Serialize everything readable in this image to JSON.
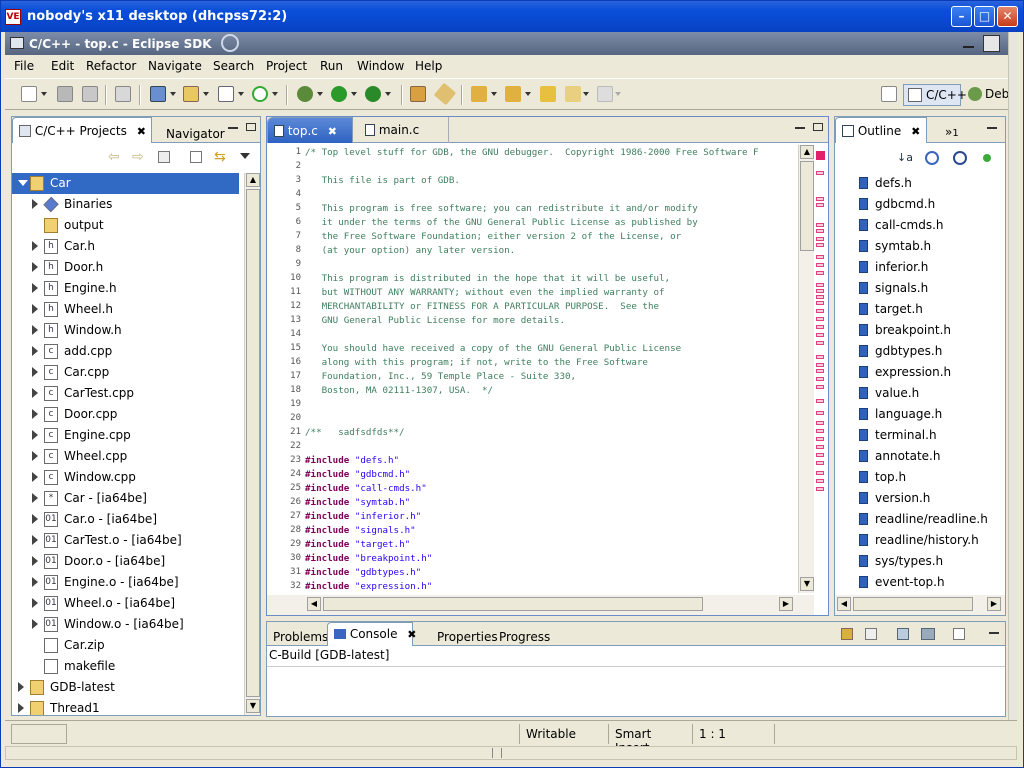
{
  "outer_window": {
    "icon": "VE",
    "title": "nobody's x11 desktop (dhcpss72:2)"
  },
  "eclipse_window": {
    "title": "C/C++ - top.c - Eclipse SDK"
  },
  "menu": [
    "File",
    "Edit",
    "Refactor",
    "Navigate",
    "Search",
    "Project",
    "Run",
    "Window",
    "Help"
  ],
  "perspectives": {
    "cpp": "C/C++",
    "debug": "Deb"
  },
  "project_view": {
    "tabs": [
      "C/C++ Projects",
      "Navigator"
    ],
    "tree": [
      {
        "label": "Car",
        "icon": "project-folder-icon",
        "expander": "open",
        "level": 0,
        "selected": true
      },
      {
        "label": "Binaries",
        "icon": "binaries-icon",
        "expander": "closed",
        "level": 1
      },
      {
        "label": "output",
        "icon": "folder-icon",
        "expander": "none",
        "level": 1
      },
      {
        "label": "Car.h",
        "icon": "header-file-icon",
        "expander": "closed",
        "level": 1
      },
      {
        "label": "Door.h",
        "icon": "header-file-icon",
        "expander": "closed",
        "level": 1
      },
      {
        "label": "Engine.h",
        "icon": "header-file-icon",
        "expander": "closed",
        "level": 1
      },
      {
        "label": "Wheel.h",
        "icon": "header-file-icon",
        "expander": "closed",
        "level": 1
      },
      {
        "label": "Window.h",
        "icon": "header-file-icon",
        "expander": "closed",
        "level": 1
      },
      {
        "label": "add.cpp",
        "icon": "source-file-icon",
        "expander": "closed",
        "level": 1
      },
      {
        "label": "Car.cpp",
        "icon": "source-file-icon",
        "expander": "closed",
        "level": 1
      },
      {
        "label": "CarTest.cpp",
        "icon": "source-file-icon",
        "expander": "closed",
        "level": 1
      },
      {
        "label": "Door.cpp",
        "icon": "source-file-icon",
        "expander": "closed",
        "level": 1
      },
      {
        "label": "Engine.cpp",
        "icon": "source-file-icon",
        "expander": "closed",
        "level": 1
      },
      {
        "label": "Wheel.cpp",
        "icon": "source-file-icon",
        "expander": "closed",
        "level": 1
      },
      {
        "label": "Window.cpp",
        "icon": "source-file-icon",
        "expander": "closed",
        "level": 1
      },
      {
        "label": "Car - [ia64be]",
        "icon": "executable-icon",
        "expander": "closed",
        "level": 1
      },
      {
        "label": "Car.o - [ia64be]",
        "icon": "object-file-icon",
        "expander": "closed",
        "level": 1
      },
      {
        "label": "CarTest.o - [ia64be]",
        "icon": "object-file-icon",
        "expander": "closed",
        "level": 1
      },
      {
        "label": "Door.o - [ia64be]",
        "icon": "object-file-icon",
        "expander": "closed",
        "level": 1
      },
      {
        "label": "Engine.o - [ia64be]",
        "icon": "object-file-icon",
        "expander": "closed",
        "level": 1
      },
      {
        "label": "Wheel.o - [ia64be]",
        "icon": "object-file-icon",
        "expander": "closed",
        "level": 1
      },
      {
        "label": "Window.o - [ia64be]",
        "icon": "object-file-icon",
        "expander": "closed",
        "level": 1
      },
      {
        "label": "Car.zip",
        "icon": "file-icon",
        "expander": "none",
        "level": 1
      },
      {
        "label": "makefile",
        "icon": "makefile-icon",
        "expander": "none",
        "level": 1
      },
      {
        "label": "GDB-latest",
        "icon": "project-folder-icon",
        "expander": "closed",
        "level": 0
      },
      {
        "label": "Thread1",
        "icon": "project-folder-icon",
        "expander": "closed",
        "level": 0
      }
    ]
  },
  "editor": {
    "tabs": [
      "top.c",
      "main.c"
    ],
    "lines": [
      {
        "n": "1",
        "t": "/* Top level stuff for GDB, the GNU debugger.  Copyright 1986-2000 Free Software F",
        "k": "cmt"
      },
      {
        "n": "2",
        "t": "",
        "k": "cmt"
      },
      {
        "n": "3",
        "t": "   This file is part of GDB.",
        "k": "cmt"
      },
      {
        "n": "4",
        "t": "",
        "k": "cmt"
      },
      {
        "n": "5",
        "t": "   This program is free software; you can redistribute it and/or modify",
        "k": "cmt"
      },
      {
        "n": "6",
        "t": "   it under the terms of the GNU General Public License as published by",
        "k": "cmt"
      },
      {
        "n": "7",
        "t": "   the Free Software Foundation; either version 2 of the License, or",
        "k": "cmt"
      },
      {
        "n": "8",
        "t": "   (at your option) any later version.",
        "k": "cmt"
      },
      {
        "n": "9",
        "t": "",
        "k": "cmt"
      },
      {
        "n": "10",
        "t": "   This program is distributed in the hope that it will be useful,",
        "k": "cmt"
      },
      {
        "n": "11",
        "t": "   but WITHOUT ANY WARRANTY; without even the implied warranty of",
        "k": "cmt"
      },
      {
        "n": "12",
        "t": "   MERCHANTABILITY or FITNESS FOR A PARTICULAR PURPOSE.  See the",
        "k": "cmt"
      },
      {
        "n": "13",
        "t": "   GNU General Public License for more details.",
        "k": "cmt"
      },
      {
        "n": "14",
        "t": "",
        "k": "cmt"
      },
      {
        "n": "15",
        "t": "   You should have received a copy of the GNU General Public License",
        "k": "cmt"
      },
      {
        "n": "16",
        "t": "   along with this program; if not, write to the Free Software",
        "k": "cmt"
      },
      {
        "n": "17",
        "t": "   Foundation, Inc., 59 Temple Place - Suite 330,",
        "k": "cmt"
      },
      {
        "n": "18",
        "t": "   Boston, MA 02111-1307, USA.  */",
        "k": "cmt"
      },
      {
        "n": "19",
        "t": "",
        "k": "cmt"
      },
      {
        "n": "20",
        "t": "",
        "k": "cmt"
      },
      {
        "n": "21",
        "t": "/**   sadfsdfds**/",
        "k": "cmt"
      },
      {
        "n": "22",
        "t": "",
        "k": "cmt"
      },
      {
        "n": "23",
        "t": "\"defs.h\"",
        "k": "inc"
      },
      {
        "n": "24",
        "t": "\"gdbcmd.h\"",
        "k": "inc"
      },
      {
        "n": "25",
        "t": "\"call-cmds.h\"",
        "k": "inc"
      },
      {
        "n": "26",
        "t": "\"symtab.h\"",
        "k": "inc"
      },
      {
        "n": "27",
        "t": "\"inferior.h\"",
        "k": "inc"
      },
      {
        "n": "28",
        "t": "\"signals.h\"",
        "k": "inc"
      },
      {
        "n": "29",
        "t": "\"target.h\"",
        "k": "inc"
      },
      {
        "n": "30",
        "t": "\"breakpoint.h\"",
        "k": "inc"
      },
      {
        "n": "31",
        "t": "\"gdbtypes.h\"",
        "k": "inc"
      },
      {
        "n": "32",
        "t": "\"expression.h\"",
        "k": "inc"
      }
    ],
    "include_keyword": "#include"
  },
  "outline": {
    "tab": "Outline",
    "extra_tab": "1",
    "items": [
      "defs.h",
      "gdbcmd.h",
      "call-cmds.h",
      "symtab.h",
      "inferior.h",
      "signals.h",
      "target.h",
      "breakpoint.h",
      "gdbtypes.h",
      "expression.h",
      "value.h",
      "language.h",
      "terminal.h",
      "annotate.h",
      "top.h",
      "version.h",
      "readline/readline.h",
      "readline/history.h",
      "sys/types.h",
      "event-top.h"
    ]
  },
  "bottom_panel": {
    "tabs": [
      "Problems",
      "Console",
      "Properties",
      "Progress"
    ],
    "console_title": "C-Build [GDB-latest]"
  },
  "status": {
    "writable": "Writable",
    "insert_mode": "Smart Insert",
    "position": "1 : 1"
  },
  "colors": {
    "selection": "#316ac5",
    "comment": "#3f7f5f",
    "keyword": "#7f0055",
    "string": "#2a00ff"
  }
}
